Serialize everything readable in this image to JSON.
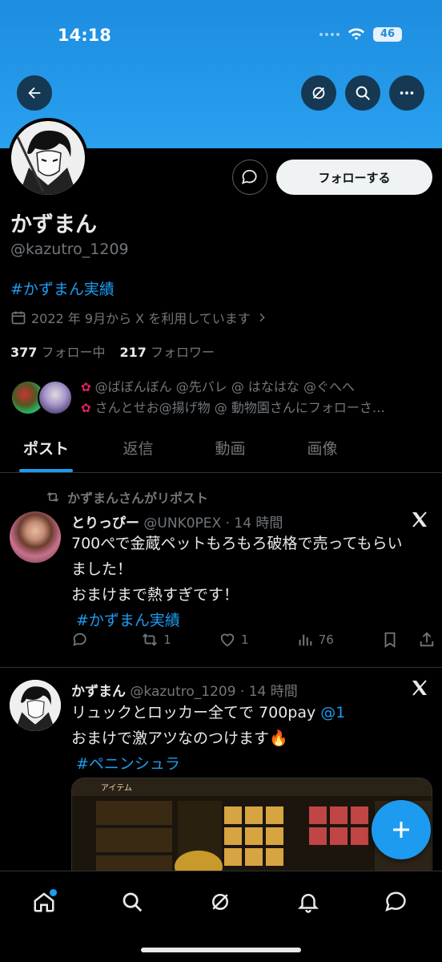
{
  "status_bar": {
    "time": "14:18",
    "battery": "46"
  },
  "profile": {
    "display_name": "かずまん",
    "handle": "@kazutro_1209",
    "bio_hashtag": "#かずまん実績",
    "joined": "2022 年 9月から X を利用しています",
    "following_count": "377",
    "following_label": "フォロー中",
    "followers_count": "217",
    "followers_label": "フォロワー",
    "follow_button": "フォローする",
    "followers_you_know_line1": "@ばぼんぼん @先バレ @ はなはな @ぐへへ",
    "followers_you_know_line2": "さんとせお@揚げ物 @ 動物園さんにフォローさ…"
  },
  "tabs": [
    {
      "label": "ポスト"
    },
    {
      "label": "返信"
    },
    {
      "label": "動画"
    },
    {
      "label": "画像"
    }
  ],
  "tweets": [
    {
      "repost_note": "かずまんさんがリポスト",
      "author": "とりっぴー",
      "meta": "@UNK0PEX · 14 時間",
      "line1": "700ぺで金蔵ペットもろもろ破格で売ってもらい",
      "line2": "ました！",
      "line3": "おまけまで熱すぎです！",
      "hashtag": "#かずまん実績",
      "replies": "",
      "reposts": "1",
      "likes": "1",
      "views": "76"
    },
    {
      "author": "かずまん",
      "meta": "@kazutro_1209 · 14 時間",
      "line1_text": "リュックとロッカー全てで 700pay ",
      "line1_mention": "@1",
      "line2": "おまけで激アツなのつけます🔥",
      "hashtag": "#ペニンシュラ",
      "media_label": "アイテム"
    }
  ],
  "colors": {
    "accent": "#1d9bf0",
    "banner": "#2aa0ef",
    "background": "#000000"
  }
}
